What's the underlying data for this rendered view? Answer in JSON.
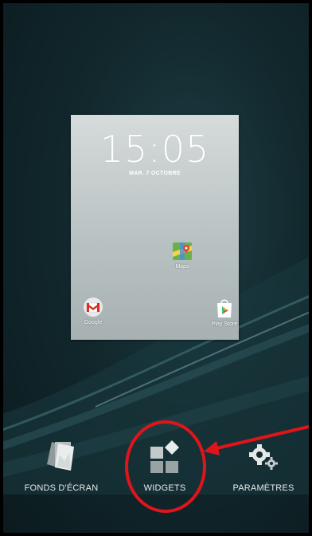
{
  "lockscreen_preview": {
    "time": "15:05",
    "date": "MAR. 7 OCTOBRE",
    "apps": [
      {
        "label": "Maps",
        "icon": "maps-icon"
      },
      {
        "label": "Google",
        "icon": "gmail-icon"
      },
      {
        "label": "Play Store",
        "icon": "play-store-icon"
      }
    ]
  },
  "bottom_menu": {
    "items": [
      {
        "label": "FONDS D'ÉCRAN",
        "icon": "wallpapers-icon"
      },
      {
        "label": "WIDGETS",
        "icon": "widgets-icon"
      },
      {
        "label": "PARAMÈTRES",
        "icon": "settings-icon"
      }
    ]
  },
  "annotation": {
    "color": "#e0141b",
    "marker": "red circle and arrow highlighting WIDGETS"
  },
  "colors": {
    "background": "#12282d",
    "label_text": "#e6eaea"
  }
}
